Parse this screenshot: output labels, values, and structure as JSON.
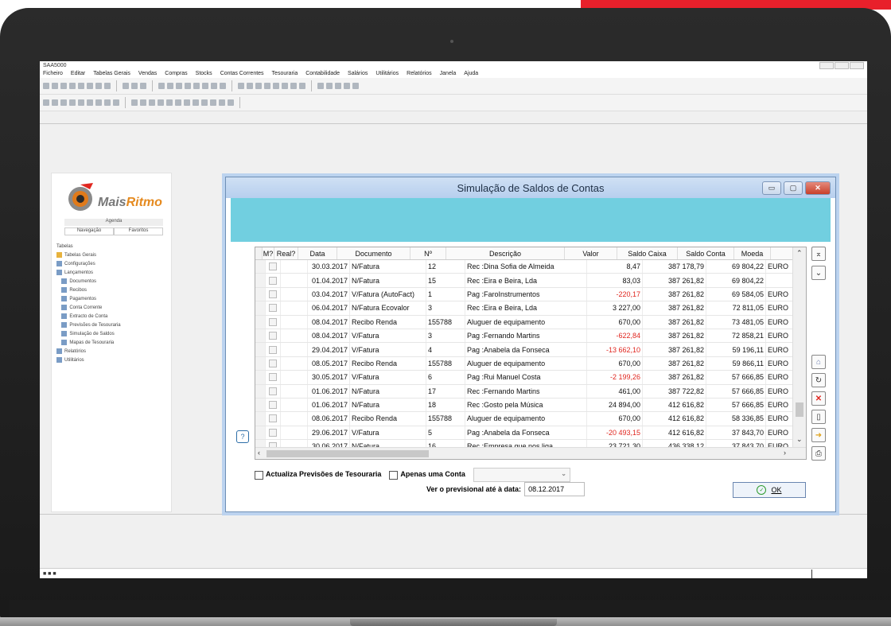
{
  "app": {
    "window_title": "SAA5000",
    "menu": [
      "Ficheiro",
      "Editar",
      "Tabelas Gerais",
      "Vendas",
      "Compras",
      "Stocks",
      "Contas Correntes",
      "Tesouraria",
      "Contabilidade",
      "Salários",
      "Utilitários",
      "Relatórios",
      "Janela",
      "Ajuda"
    ]
  },
  "sidebar": {
    "brand_prefix": "Mais",
    "brand_suffix": "Ritmo",
    "header": "Agenda",
    "tabs": [
      "Navegação",
      "Favoritos"
    ],
    "tree": [
      "Tabelas",
      "Tabelas Gerais",
      "Configurações",
      "Lançamentos",
      "Documentos",
      "Recibos",
      "Pagamentos",
      "Conta Corrente",
      "Extracto de Conta",
      "Previsões de Tesouraria",
      "Simulação de Saldos",
      "Mapas de Tesouraria",
      "Relatórios",
      "Utilitários"
    ]
  },
  "dialog": {
    "title": "Simulação de Saldos de Contas",
    "columns": [
      "M?",
      "Real?",
      "Data",
      "Documento",
      "Nº",
      "Descrição",
      "Valor",
      "Saldo Caixa",
      "Saldo Conta",
      "Moeda"
    ],
    "rows": [
      {
        "data": "30.03.2017",
        "doc": "N/Fatura",
        "num": "12",
        "desc": "Rec :Dina Sofia de Almeida",
        "valor": "8,47",
        "caixa": "387 178,79",
        "conta": "69 804,22",
        "moeda": "EURO",
        "neg": false
      },
      {
        "data": "01.04.2017",
        "doc": "N/Fatura",
        "num": "15",
        "desc": "Rec :Eira e Beira, Lda",
        "valor": "83,03",
        "caixa": "387 261,82",
        "conta": "69 804,22",
        "moeda": "",
        "neg": false
      },
      {
        "data": "03.04.2017",
        "doc": "V/Fatura (AutoFact)",
        "num": "1",
        "desc": "Pag :FaroInstrumentos",
        "valor": "-220,17",
        "caixa": "387 261,82",
        "conta": "69 584,05",
        "moeda": "EURO",
        "neg": true
      },
      {
        "data": "06.04.2017",
        "doc": "N/Fatura Ecovalor",
        "num": "3",
        "desc": "Rec :Eira e Beira, Lda",
        "valor": "3 227,00",
        "caixa": "387 261,82",
        "conta": "72 811,05",
        "moeda": "EURO",
        "neg": false
      },
      {
        "data": "08.04.2017",
        "doc": "Recibo Renda",
        "num": "155788",
        "desc": "Aluguer de equipamento",
        "valor": "670,00",
        "caixa": "387 261,82",
        "conta": "73 481,05",
        "moeda": "EURO",
        "neg": false
      },
      {
        "data": "08.04.2017",
        "doc": "V/Fatura",
        "num": "3",
        "desc": "Pag :Fernando Martins",
        "valor": "-622,84",
        "caixa": "387 261,82",
        "conta": "72 858,21",
        "moeda": "EURO",
        "neg": true
      },
      {
        "data": "29.04.2017",
        "doc": "V/Fatura",
        "num": "4",
        "desc": "Pag :Anabela da Fonseca",
        "valor": "-13 662,10",
        "caixa": "387 261,82",
        "conta": "59 196,11",
        "moeda": "EURO",
        "neg": true
      },
      {
        "data": "08.05.2017",
        "doc": "Recibo Renda",
        "num": "155788",
        "desc": "Aluguer de equipamento",
        "valor": "670,00",
        "caixa": "387 261,82",
        "conta": "59 866,11",
        "moeda": "EURO",
        "neg": false
      },
      {
        "data": "30.05.2017",
        "doc": "V/Fatura",
        "num": "6",
        "desc": "Pag :Rui Manuel Costa",
        "valor": "-2 199,26",
        "caixa": "387 261,82",
        "conta": "57 666,85",
        "moeda": "EURO",
        "neg": true
      },
      {
        "data": "01.06.2017",
        "doc": "N/Fatura",
        "num": "17",
        "desc": "Rec :Fernando Martins",
        "valor": "461,00",
        "caixa": "387 722,82",
        "conta": "57 666,85",
        "moeda": "EURO",
        "neg": false
      },
      {
        "data": "01.06.2017",
        "doc": "N/Fatura",
        "num": "18",
        "desc": "Rec :Gosto pela Música",
        "valor": "24 894,00",
        "caixa": "412 616,82",
        "conta": "57 666,85",
        "moeda": "EURO",
        "neg": false
      },
      {
        "data": "08.06.2017",
        "doc": "Recibo Renda",
        "num": "155788",
        "desc": "Aluguer de equipamento",
        "valor": "670,00",
        "caixa": "412 616,82",
        "conta": "58 336,85",
        "moeda": "EURO",
        "neg": false
      },
      {
        "data": "29.06.2017",
        "doc": "V/Fatura",
        "num": "5",
        "desc": "Pag :Anabela da Fonseca",
        "valor": "-20 493,15",
        "caixa": "412 616,82",
        "conta": "37 843,70",
        "moeda": "EURO",
        "neg": true
      },
      {
        "data": "30.06.2017",
        "doc": "N/Fatura",
        "num": "16",
        "desc": "Rec :Empresa que nos liga",
        "valor": "23 721,30",
        "caixa": "436 338,12",
        "conta": "37 843,70",
        "moeda": "EURO",
        "neg": false
      }
    ],
    "actualiza_label": "Actualiza Previsões de Tesouraria",
    "apenas_label": "Apenas uma Conta",
    "ver_label": "Ver o previsional até à data:",
    "ver_value": "08.12.2017",
    "ok_label": "OK"
  },
  "colors": {
    "accent_red": "#e8202b",
    "banner": "#71cfe0",
    "negative": "#e0261f"
  }
}
